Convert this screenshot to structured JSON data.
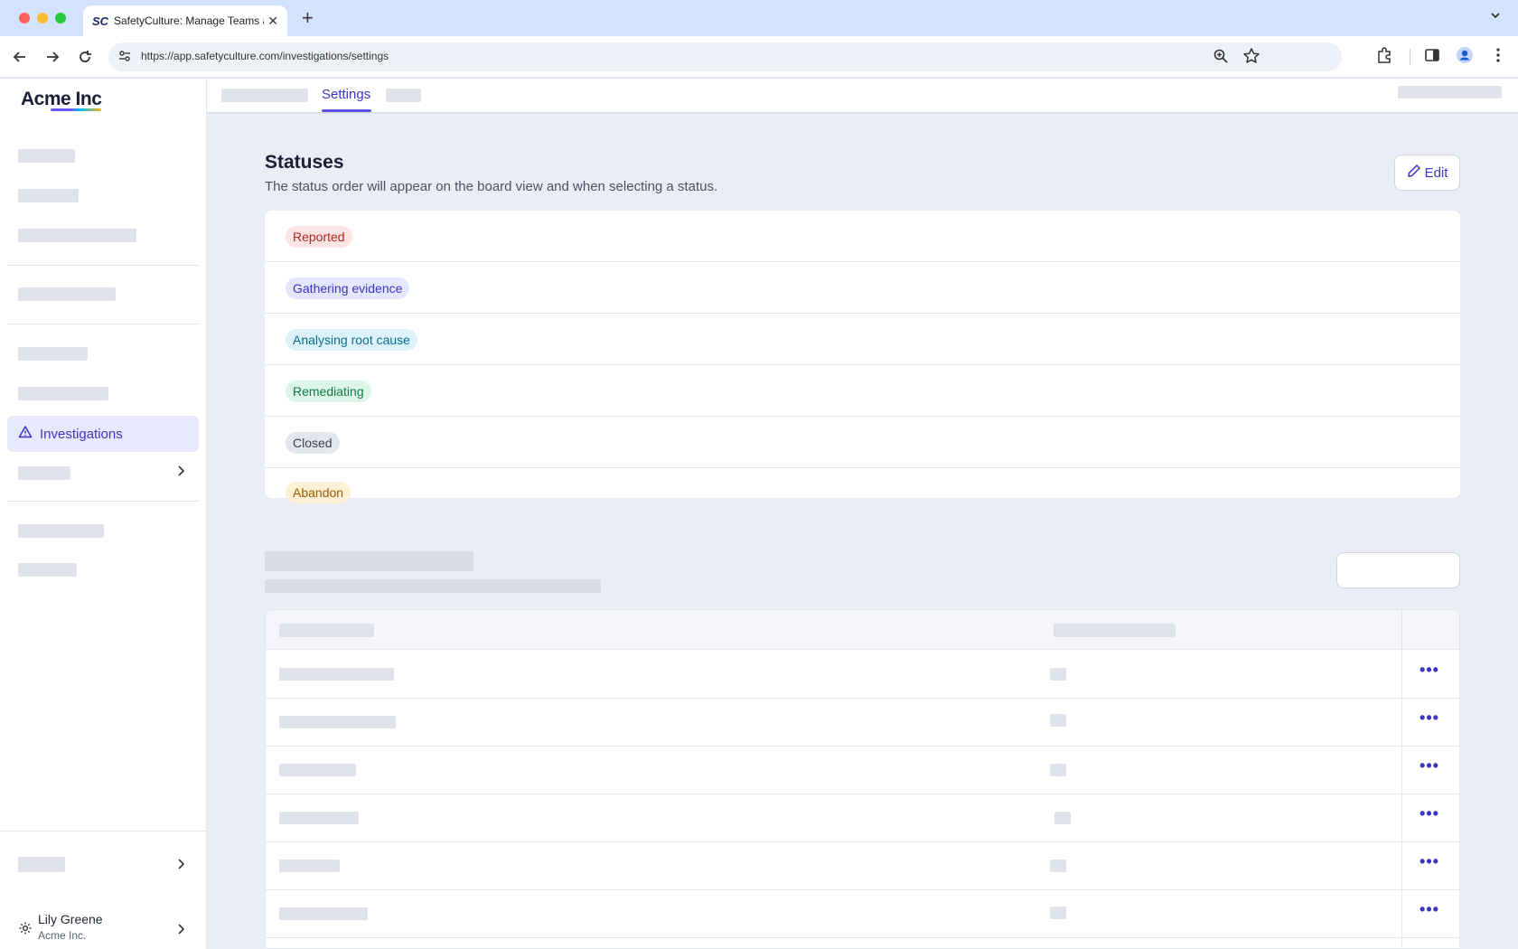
{
  "browser": {
    "tab_title": "SafetyCulture: Manage Teams and...",
    "tab_favicon": "SC",
    "tab_close_icon": "close-icon",
    "new_tab_icon": "plus-icon",
    "url": "https://app.safetyculture.com/investigations/settings"
  },
  "sidebar": {
    "logo": "Acme Inc",
    "active_item": "Investigations",
    "user_name": "Lily Greene",
    "user_org": "Acme Inc."
  },
  "topbar": {
    "active_tab": "Settings"
  },
  "statuses": {
    "title": "Statuses",
    "description": "The status order will appear on the board view and when selecting a status.",
    "edit_label": "Edit",
    "items": [
      {
        "label": "Reported",
        "bg": "#fde4e4",
        "fg": "#b3261e"
      },
      {
        "label": "Gathering evidence",
        "bg": "#e4e6fd",
        "fg": "#3b35c4"
      },
      {
        "label": "Analysing root cause",
        "bg": "#dcf3fb",
        "fg": "#0b6e8f"
      },
      {
        "label": "Remediating",
        "bg": "#ddf5e8",
        "fg": "#127a45"
      },
      {
        "label": "Closed",
        "bg": "#e3e6ec",
        "fg": "#3a4152"
      },
      {
        "label": "Abandon",
        "bg": "#fdf0d5",
        "fg": "#9a5b00"
      }
    ]
  },
  "table": {
    "row_action_icon": "more-horizontal-icon",
    "row_action_label": "•••"
  }
}
